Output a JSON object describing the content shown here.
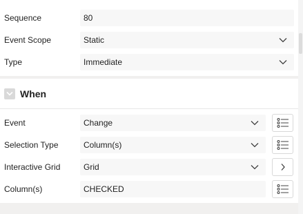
{
  "properties": {
    "sequence": {
      "label": "Sequence",
      "value": "80"
    },
    "event_scope": {
      "label": "Event Scope",
      "value": "Static"
    },
    "type": {
      "label": "Type",
      "value": "Immediate"
    }
  },
  "when": {
    "title": "When",
    "event": {
      "label": "Event",
      "value": "Change"
    },
    "selection_type": {
      "label": "Selection Type",
      "value": "Column(s)"
    },
    "interactive_grid": {
      "label": "Interactive Grid",
      "value": "Grid"
    },
    "columns": {
      "label": "Column(s)",
      "value": "CHECKED"
    }
  },
  "icons": {
    "dropdown": "chevron-down-icon",
    "list": "list-icon",
    "navigate": "chevron-right-icon",
    "collapse": "chevron-down-icon"
  },
  "colors": {
    "background": "#f1f0ef",
    "panel": "#ffffff",
    "field": "#f7f7f7",
    "toggle": "#d9d9d9"
  }
}
